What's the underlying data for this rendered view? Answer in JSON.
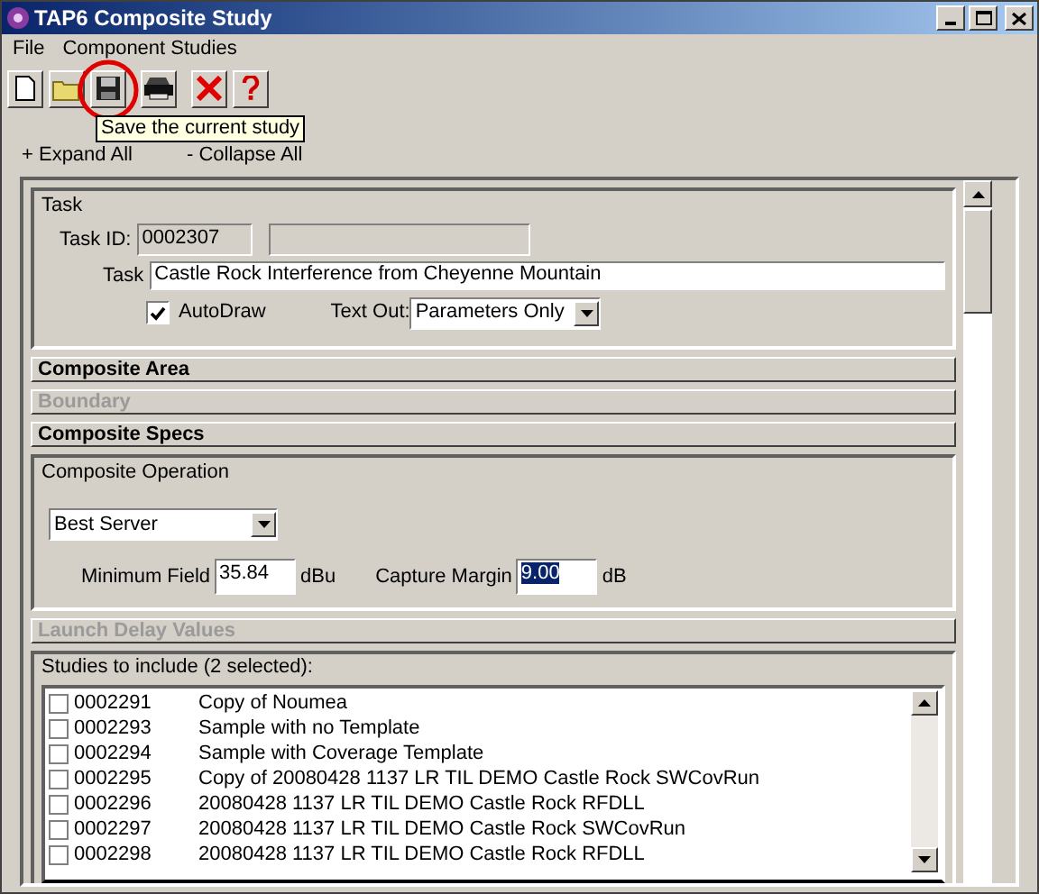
{
  "window": {
    "title": "TAP6 Composite Study"
  },
  "menu": [
    "File",
    "Component Studies"
  ],
  "toolbar": [
    {
      "kind": "new",
      "highlighted": false
    },
    {
      "kind": "open",
      "highlighted": false
    },
    {
      "kind": "save",
      "highlighted": true
    },
    {
      "kind": "print",
      "highlighted": false
    },
    {
      "kind": "delete",
      "highlighted": false
    },
    {
      "kind": "help",
      "highlighted": false
    }
  ],
  "tooltip": "Save the current study",
  "outline_links": [
    "+ Expand All",
    "- Collapse All"
  ],
  "sections": [
    {
      "kind": "task",
      "title": "Task",
      "id_label": "Task ID:",
      "id_value": "0002307",
      "task_label": "Task",
      "task_value": "Castle Rock Interference from Cheyenne Mountain",
      "autodraw": {
        "label": "AutoDraw",
        "checked": true
      },
      "text_out": {
        "label": "Text Out:",
        "value": "Parameters Only"
      }
    },
    {
      "kind": "header",
      "title": "Composite Area",
      "disabled": false
    },
    {
      "kind": "header",
      "title": "Boundary",
      "disabled": true
    },
    {
      "kind": "header",
      "title": "Composite Specs",
      "disabled": false
    },
    {
      "kind": "operation",
      "title": "Composite Operation",
      "operation": "Best Server",
      "fields": [
        {
          "label": "Minimum Field",
          "value": "35.84",
          "unit": "dBu",
          "selected": false
        },
        {
          "label": "Capture Margin",
          "value": "9.00",
          "unit": "dB",
          "selected": true
        }
      ]
    },
    {
      "kind": "header",
      "title": "Launch Delay Values",
      "disabled": true
    },
    {
      "kind": "studies",
      "title": "Studies to include (2 selected):",
      "rows": [
        {
          "id": "0002291",
          "name": "Copy of Noumea",
          "checked": false
        },
        {
          "id": "0002293",
          "name": "Sample with no Template",
          "checked": false
        },
        {
          "id": "0002294",
          "name": "Sample with Coverage Template",
          "checked": false
        },
        {
          "id": "0002295",
          "name": "Copy of 20080428 1137 LR TIL DEMO Castle Rock SWCovRun",
          "checked": false
        },
        {
          "id": "0002296",
          "name": "20080428 1137 LR TIL DEMO Castle Rock RFDLL",
          "checked": false
        },
        {
          "id": "0002297",
          "name": "20080428 1137 LR TIL DEMO Castle Rock SWCovRun",
          "checked": false
        },
        {
          "id": "0002298",
          "name": "20080428 1137 LR TIL DEMO Castle Rock RFDLL",
          "checked": false
        }
      ]
    }
  ]
}
